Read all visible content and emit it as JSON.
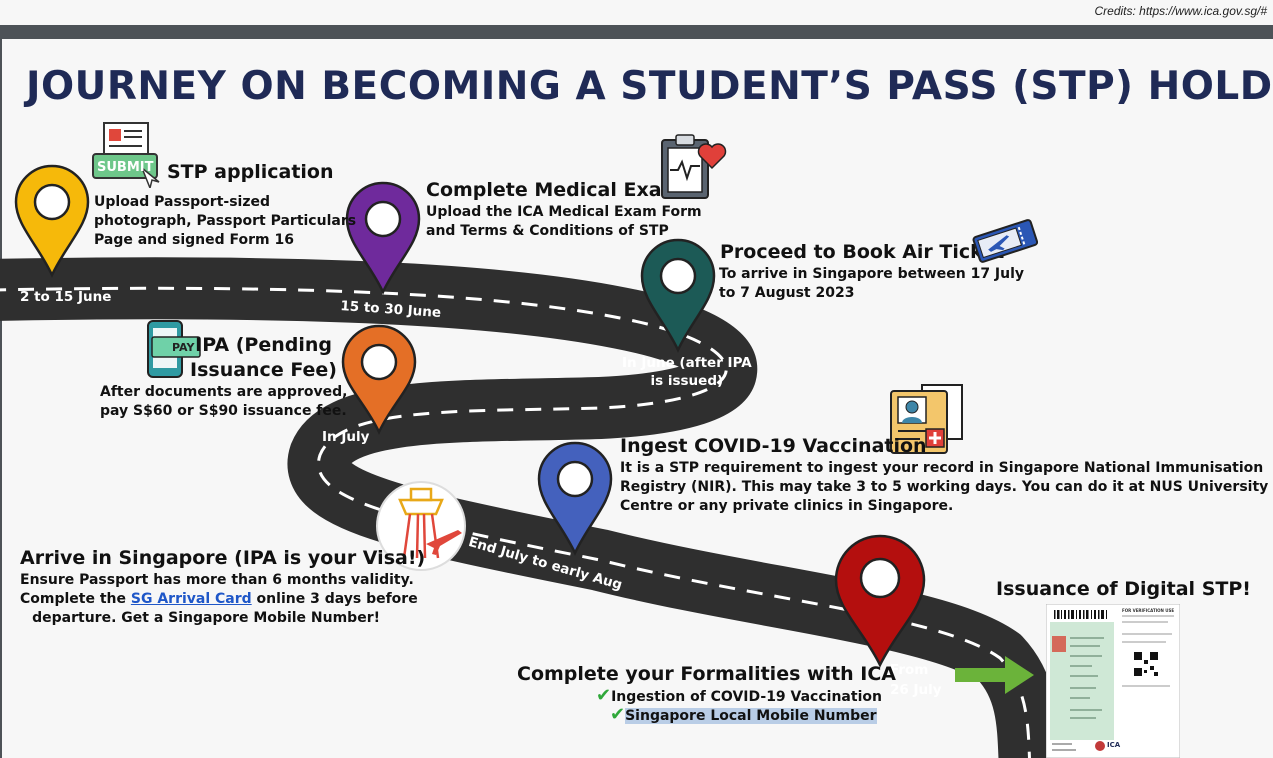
{
  "credits": "Credits: https://www.ica.gov.sg/#",
  "title": "JOURNEY ON BECOMING A STUDENT’S PASS (STP) HOLDER",
  "steps": {
    "stp_application": {
      "heading": "STP application",
      "icon_label": "SUBMIT",
      "lines": [
        "Upload Passport-sized",
        "photograph, Passport Particulars",
        "Page and signed Form 16"
      ],
      "date": "2 to 15 June",
      "pin_color": "#f6b90a"
    },
    "medical_exam": {
      "heading": "Complete Medical Exam",
      "lines": [
        "Upload the ICA Medical Exam Form",
        "and Terms & Conditions of STP"
      ],
      "date": "15 to 30 June",
      "pin_color": "#6f2a9c"
    },
    "air_ticket": {
      "heading": "Proceed to Book Air Ticket",
      "lines": [
        "To arrive in Singapore between 17 July",
        "to 7 August 2023"
      ],
      "date_lines": [
        "In June (after IPA",
        "is issued)"
      ],
      "pin_color": "#1c5a56"
    },
    "ipa": {
      "heading_lines": [
        "IPA (Pending",
        "Issuance Fee)"
      ],
      "icon_label": "PAY",
      "lines": [
        "After documents are approved,",
        "pay S$60 or S$90 issuance fee."
      ],
      "date": "In July",
      "pin_color": "#e46f26"
    },
    "covid": {
      "heading": "Ingest COVID-19 Vaccination",
      "lines": [
        "It is a STP requirement to ingest your record in Singapore National Immunisation",
        "Registry (NIR). This may take 3 to 5 working days. You can do it at NUS University Health",
        "Centre or any private clinics in Singapore."
      ],
      "date": "End July to early Aug",
      "pin_color": "#4461bd"
    },
    "arrive": {
      "heading": "Arrive in Singapore (IPA is your Visa!)",
      "line1": "Ensure Passport has more than 6 months validity.",
      "line2_pre": "Complete the ",
      "line2_link": "SG Arrival Card",
      "line2_post": " online 3 days before",
      "line3": "departure. Get a Singapore Mobile Number!"
    },
    "formalities": {
      "heading": "Complete your Formalities with ICA",
      "checks": [
        "Ingestion of COVID-19 Vaccination",
        "Singapore Local Mobile Number"
      ],
      "date_lines": [
        "From",
        "26 July"
      ],
      "pin_color": "#b40f0e"
    },
    "digital_stp": {
      "heading": "Issuance of Digital STP!",
      "card_title": "FOR VERIFICATION USE",
      "card_agency": "ICA"
    }
  },
  "colors": {
    "road": "#2f2f2f",
    "title": "#1f2a56",
    "arrow": "#6bb33a",
    "check": "#2fa83a"
  }
}
